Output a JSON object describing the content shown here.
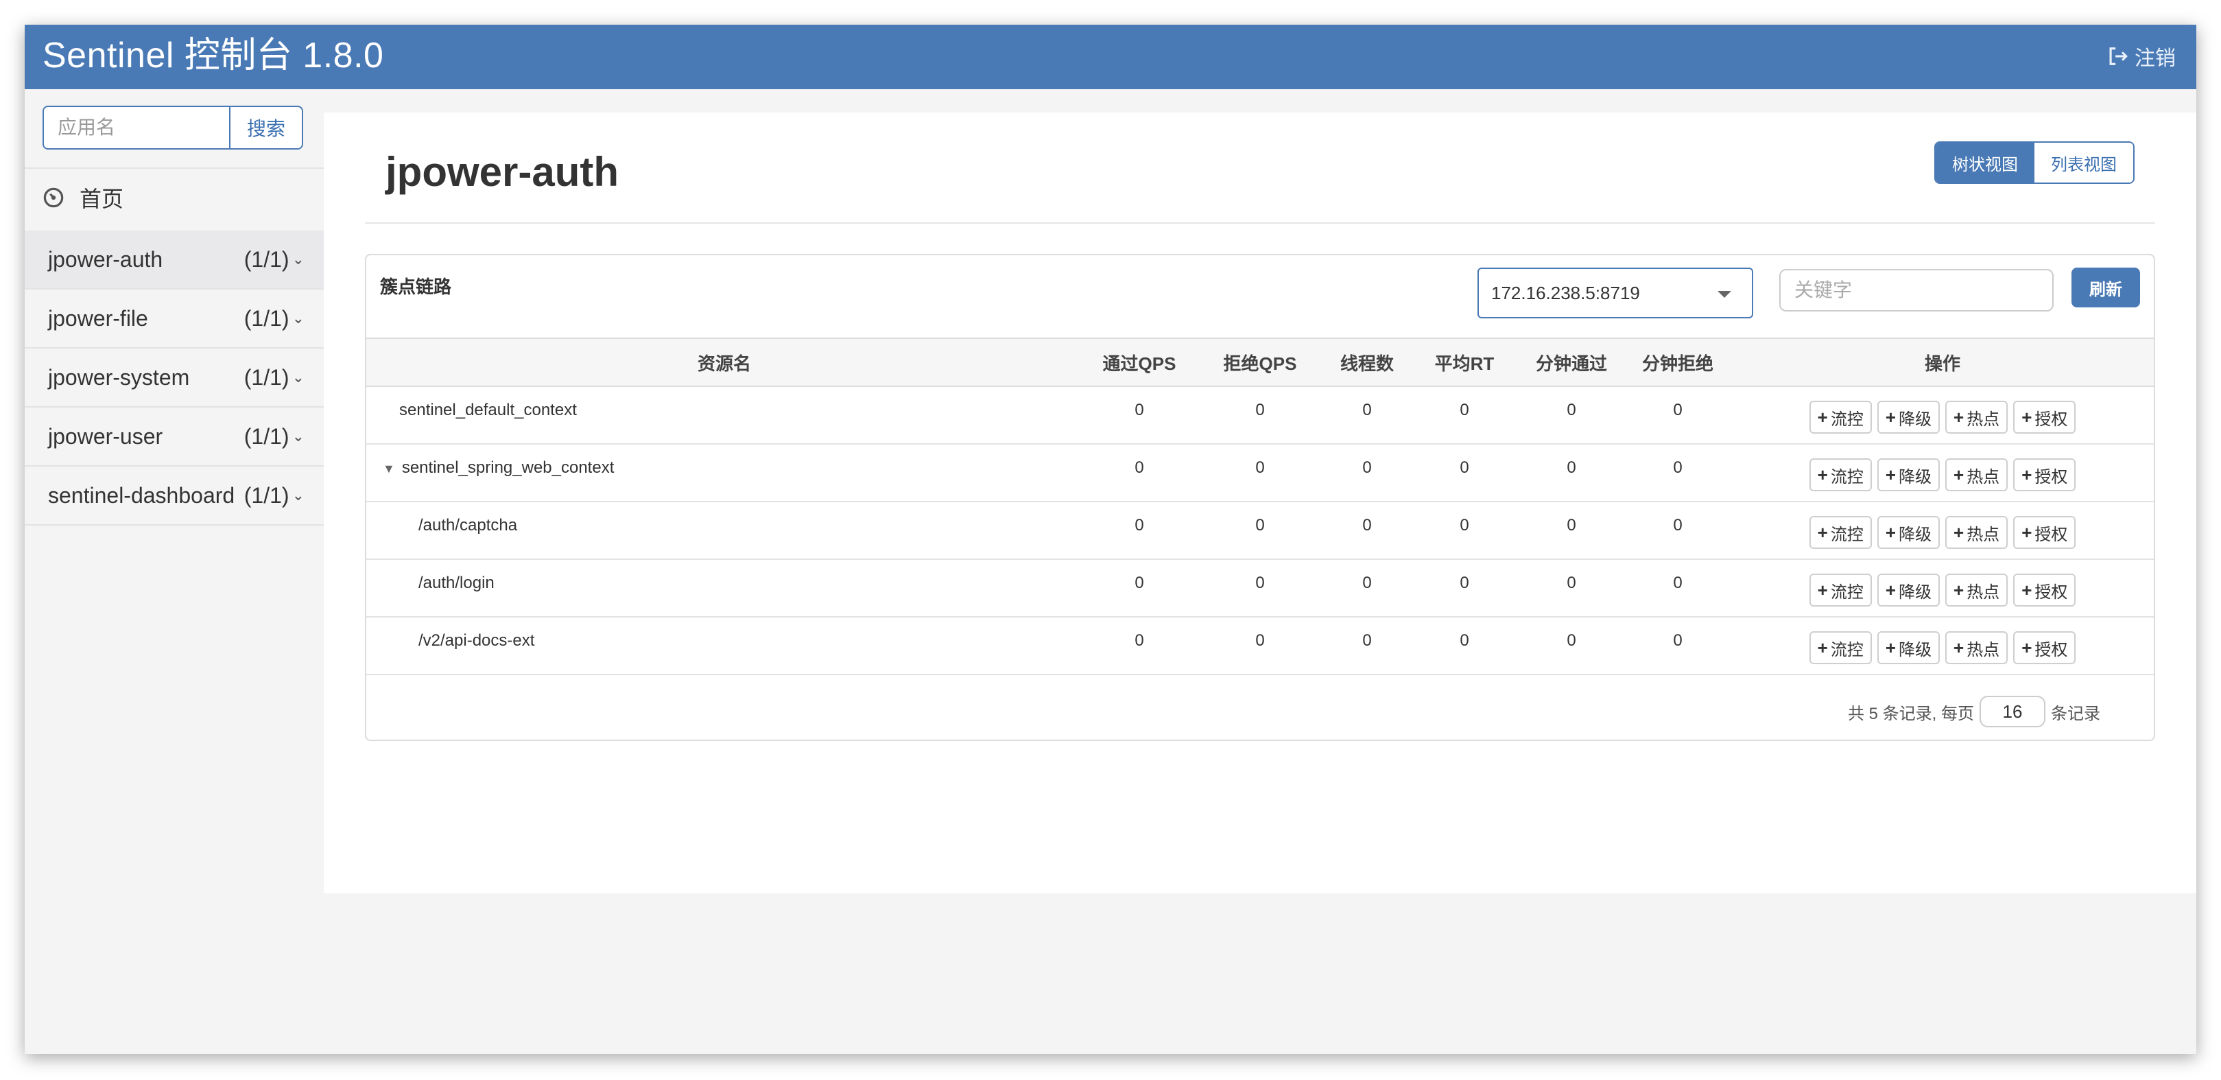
{
  "header": {
    "brand": "Sentinel 控制台 1.8.0",
    "logout_label": "注销"
  },
  "sidebar": {
    "search_placeholder": "应用名",
    "search_button": "搜索",
    "home_label": "首页",
    "apps": [
      {
        "name": "jpower-auth",
        "count": "(1/1)",
        "active": true
      },
      {
        "name": "jpower-file",
        "count": "(1/1)"
      },
      {
        "name": "jpower-system",
        "count": "(1/1)"
      },
      {
        "name": "jpower-user",
        "count": "(1/1)"
      },
      {
        "name": "sentinel-dashboard",
        "count": "(1/1)"
      }
    ]
  },
  "main": {
    "title": "jpower-auth",
    "view_tree": "树状视图",
    "view_list": "列表视图",
    "panel_title": "簇点链路",
    "machine": "172.16.238.5:8719",
    "keyword_placeholder": "关键字",
    "refresh": "刷新",
    "columns": [
      "资源名",
      "通过QPS",
      "拒绝QPS",
      "线程数",
      "平均RT",
      "分钟通过",
      "分钟拒绝",
      "操作"
    ],
    "rows": [
      {
        "name": "sentinel_default_context",
        "values": [
          "0",
          "0",
          "0",
          "0",
          "0",
          "0"
        ]
      },
      {
        "name": "sentinel_spring_web_context",
        "values": [
          "0",
          "0",
          "0",
          "0",
          "0",
          "0"
        ]
      },
      {
        "name": "/auth/captcha",
        "values": [
          "0",
          "0",
          "0",
          "0",
          "0",
          "0"
        ]
      },
      {
        "name": "/auth/login",
        "values": [
          "0",
          "0",
          "0",
          "0",
          "0",
          "0"
        ]
      },
      {
        "name": "/v2/api-docs-ext",
        "values": [
          "0",
          "0",
          "0",
          "0",
          "0",
          "0"
        ]
      }
    ],
    "ops": [
      "流控",
      "降级",
      "热点",
      "授权"
    ],
    "pager": {
      "prefix": "共 5 条记录, 每页",
      "page_size": "16",
      "suffix": "条记录"
    }
  }
}
